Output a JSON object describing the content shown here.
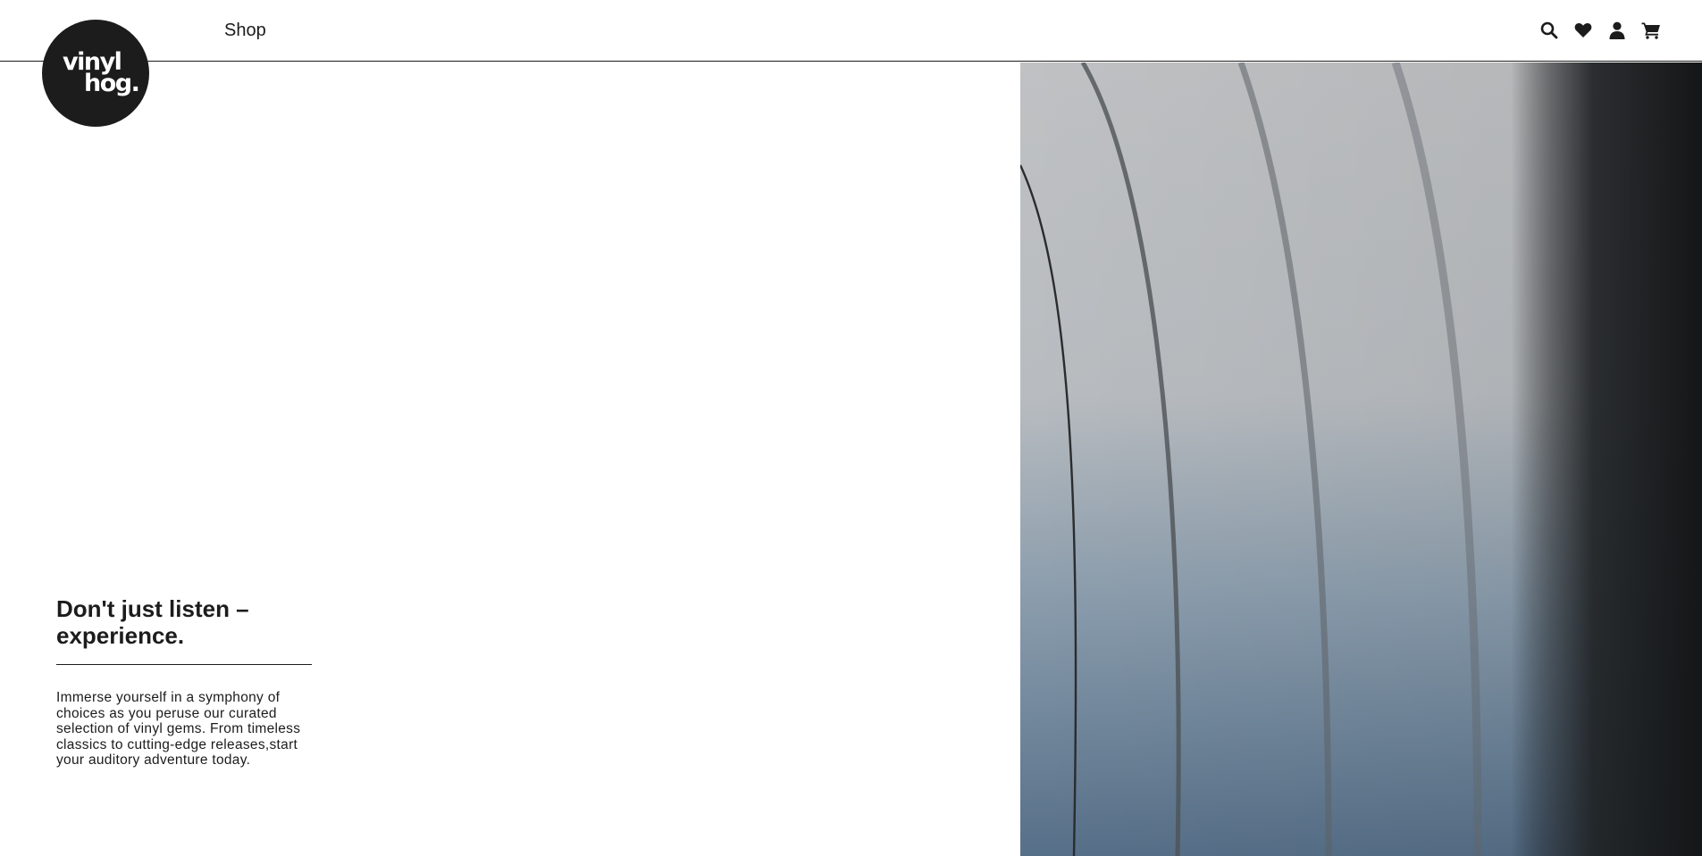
{
  "brand": {
    "logo_line1": "vinyl",
    "logo_line2": "hog."
  },
  "nav": {
    "shop_label": "Shop"
  },
  "header_icons": [
    "search-icon",
    "heart-icon",
    "user-icon",
    "cart-icon"
  ],
  "hero": {
    "headline": "Don't just listen – experience.",
    "body": "Immerse yourself in a symphony of choices as you peruse our curated selection of vinyl gems. From timeless classics to cutting-edge releases,start your auditory adventure today."
  },
  "colors": {
    "text": "#1c1c1c",
    "background": "#ffffff",
    "logo_bg": "#1c1c1c"
  }
}
